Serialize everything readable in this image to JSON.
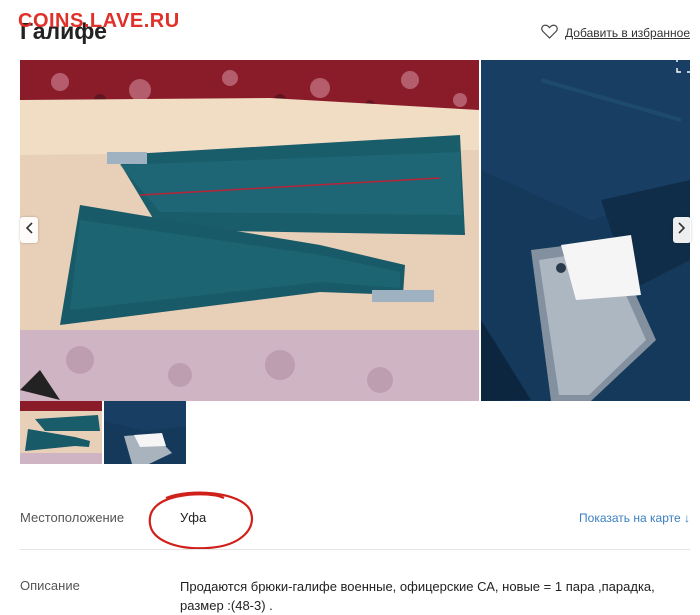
{
  "watermark": "COINS.LAVE.RU",
  "header": {
    "title": "Галифе",
    "favorite_label": "Добавить в избранное"
  },
  "gallery": {
    "main_photo": "photo-trousers-on-carpet",
    "second_photo": "photo-trousers-inside-closeup",
    "thumbnails": [
      "thumb-trousers-on-carpet",
      "thumb-trousers-inside-closeup"
    ]
  },
  "location": {
    "label": "Местоположение",
    "value": "Уфа",
    "map_link": "Показать на карте ↓"
  },
  "description": {
    "label": "Описание",
    "text": "Продаются брюки-галифе военные, офицерские СА, новые = 1 пара ,парадка, размер :(48-3) ."
  },
  "colors": {
    "watermark": "#e0302a",
    "link": "#3a7fc1",
    "trousers": "#185e6c",
    "annotation": "#d0201a"
  }
}
